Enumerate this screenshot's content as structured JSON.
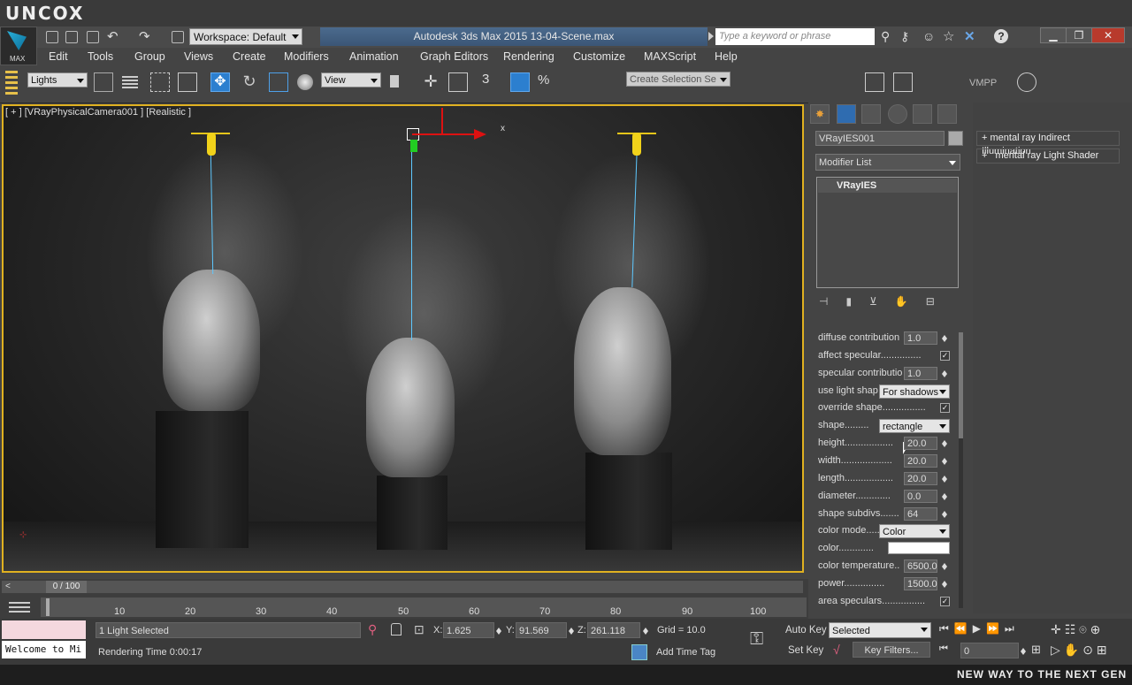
{
  "branding": {
    "watermark_logo": "UNCOX"
  },
  "titlebar": {
    "app_title": "Autodesk 3ds Max  2015     13-04-Scene.max",
    "workspace": "Workspace: Default",
    "search_placeholder": "Type a keyword or phrase",
    "max_button_label": "MAX"
  },
  "menu": {
    "items": [
      "Edit",
      "Tools",
      "Group",
      "Views",
      "Create",
      "Modifiers",
      "Animation",
      "Graph Editors",
      "Rendering",
      "Customize",
      "MAXScript",
      "Help"
    ]
  },
  "toolbar": {
    "selection_filter": "Lights",
    "reference_coord": "View",
    "snap_label": "3",
    "named_selection_placeholder": "Create Selection Se",
    "vmpp_label": "VMPP"
  },
  "viewport": {
    "label": "[ + ] [VRayPhysicalCamera001 ] [Realistic ]",
    "gizmo_axis": "x"
  },
  "timeline": {
    "frame_display": "0 / 100",
    "ticks": [
      "10",
      "20",
      "30",
      "40",
      "50",
      "60",
      "70",
      "80",
      "90",
      "100"
    ]
  },
  "status": {
    "listener": "Welcome to Mi",
    "selection_text": "1 Light Selected",
    "rendering_time": "Rendering Time  0:00:17",
    "x_label": "X:",
    "x_value": "1.625",
    "y_label": "Y:",
    "y_value": "91.569",
    "z_label": "Z:",
    "z_value": "261.118",
    "grid": "Grid = 10.0",
    "add_time_tag": "Add Time Tag",
    "auto_key": "Auto Key",
    "set_key": "Set Key",
    "key_mode": "Selected",
    "key_filters": "Key Filters...",
    "current_frame": "0"
  },
  "command_panel": {
    "object_name": "VRayIES001",
    "modifier_list": "Modifier List",
    "stack_item": "VRayIES",
    "params": [
      {
        "label": "diffuse contribution",
        "type": "spinner",
        "value": "1.0"
      },
      {
        "label": "affect specular...............",
        "type": "check",
        "value": "✓"
      },
      {
        "label": "specular contributio",
        "type": "spinner",
        "value": "1.0"
      },
      {
        "label": "use light shap",
        "type": "select",
        "value": "For shadows"
      },
      {
        "label": "override shape................",
        "type": "check",
        "value": "✓"
      },
      {
        "label": "shape.........",
        "type": "select",
        "value": "rectangle"
      },
      {
        "label": "height..................",
        "type": "spinner",
        "value": "20.0"
      },
      {
        "label": "width...................",
        "type": "spinner",
        "value": "20.0"
      },
      {
        "label": "length..................",
        "type": "spinner",
        "value": "20.0"
      },
      {
        "label": "diameter.............",
        "type": "spinner",
        "value": "0.0"
      },
      {
        "label": "shape subdivs.......",
        "type": "spinner",
        "value": "64"
      },
      {
        "label": "color mode.....",
        "type": "select",
        "value": "Color"
      },
      {
        "label": "color.............",
        "type": "color",
        "value": "#ffffff"
      },
      {
        "label": "color temperature..",
        "type": "spinner",
        "value": "6500.0"
      },
      {
        "label": "power...............",
        "type": "spinner",
        "value": "1500.0"
      },
      {
        "label": "area speculars................",
        "type": "check",
        "value": "✓"
      }
    ]
  },
  "right_panel": {
    "items": [
      "mental ray Indirect Illumination",
      "mental ray Light Shader"
    ],
    "prefixes": [
      "+",
      "+"
    ]
  },
  "bottom_banner": "NEW WAY TO THE NEXT GEN"
}
